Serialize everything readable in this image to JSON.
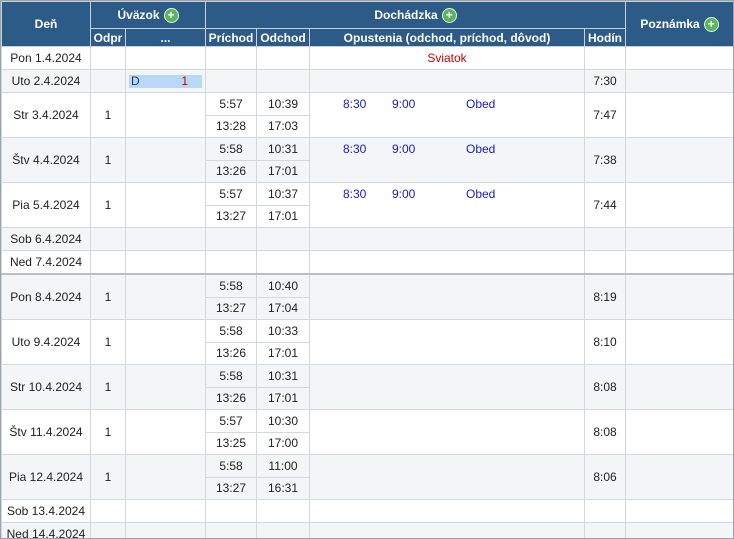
{
  "header": {
    "den": "Deň",
    "uvazok": "Úväzok",
    "dochadzka": "Dochádzka",
    "poznamka": "Poznámka",
    "odpr": "Odpr",
    "dots": "...",
    "prichod": "Príchod",
    "odchod": "Odchod",
    "opustenia": "Opustenia (odchod, príchod, dôvod)",
    "hodin": "Hodín",
    "plus": "+"
  },
  "rows": [
    {
      "day": "Pon 1.4.2024",
      "odpr": "",
      "uvz": null,
      "times": [],
      "exits": [],
      "note": "Sviatok",
      "hodin": ""
    },
    {
      "day": "Uto 2.4.2024",
      "odpr": "",
      "uvz": {
        "code": "D",
        "count": "1"
      },
      "times": [],
      "exits": [],
      "note": "",
      "hodin": "7:30"
    },
    {
      "day": "Str 3.4.2024",
      "odpr": "1",
      "uvz": null,
      "times": [
        [
          "5:57",
          "10:39"
        ],
        [
          "13:28",
          "17:03"
        ]
      ],
      "exits": [
        [
          "8:30",
          "9:00",
          "Obed"
        ]
      ],
      "note": "",
      "hodin": "7:47"
    },
    {
      "day": "Štv 4.4.2024",
      "odpr": "1",
      "uvz": null,
      "times": [
        [
          "5:58",
          "10:31"
        ],
        [
          "13:26",
          "17:01"
        ]
      ],
      "exits": [
        [
          "8:30",
          "9:00",
          "Obed"
        ]
      ],
      "note": "",
      "hodin": "7:38"
    },
    {
      "day": "Pia 5.4.2024",
      "odpr": "1",
      "uvz": null,
      "times": [
        [
          "5:57",
          "10:37"
        ],
        [
          "13:27",
          "17:01"
        ]
      ],
      "exits": [
        [
          "8:30",
          "9:00",
          "Obed"
        ]
      ],
      "note": "",
      "hodin": "7:44"
    },
    {
      "day": "Sob 6.4.2024",
      "odpr": "",
      "uvz": null,
      "times": [],
      "exits": [],
      "note": "",
      "hodin": ""
    },
    {
      "day": "Ned 7.4.2024",
      "odpr": "",
      "uvz": null,
      "times": [],
      "exits": [],
      "note": "",
      "hodin": ""
    },
    {
      "day": "Pon 8.4.2024",
      "odpr": "1",
      "uvz": null,
      "times": [
        [
          "5:58",
          "10:40"
        ],
        [
          "13:27",
          "17:04"
        ]
      ],
      "exits": [],
      "note": "",
      "hodin": "8:19",
      "weekStart": true
    },
    {
      "day": "Uto 9.4.2024",
      "odpr": "1",
      "uvz": null,
      "times": [
        [
          "5:58",
          "10:33"
        ],
        [
          "13:26",
          "17:01"
        ]
      ],
      "exits": [],
      "note": "",
      "hodin": "8:10"
    },
    {
      "day": "Str 10.4.2024",
      "odpr": "1",
      "uvz": null,
      "times": [
        [
          "5:58",
          "10:31"
        ],
        [
          "13:26",
          "17:01"
        ]
      ],
      "exits": [],
      "note": "",
      "hodin": "8:08"
    },
    {
      "day": "Štv 11.4.2024",
      "odpr": "1",
      "uvz": null,
      "times": [
        [
          "5:57",
          "10:30"
        ],
        [
          "13:25",
          "17:00"
        ]
      ],
      "exits": [],
      "note": "",
      "hodin": "8:08"
    },
    {
      "day": "Pia 12.4.2024",
      "odpr": "1",
      "uvz": null,
      "times": [
        [
          "5:58",
          "11:00"
        ],
        [
          "13:27",
          "16:31"
        ]
      ],
      "exits": [],
      "note": "",
      "hodin": "8:06"
    },
    {
      "day": "Sob 13.4.2024",
      "odpr": "",
      "uvz": null,
      "times": [],
      "exits": [],
      "note": "",
      "hodin": ""
    },
    {
      "day": "Ned 14.4.2024",
      "odpr": "",
      "uvz": null,
      "times": [],
      "exits": [],
      "note": "",
      "hodin": ""
    }
  ]
}
